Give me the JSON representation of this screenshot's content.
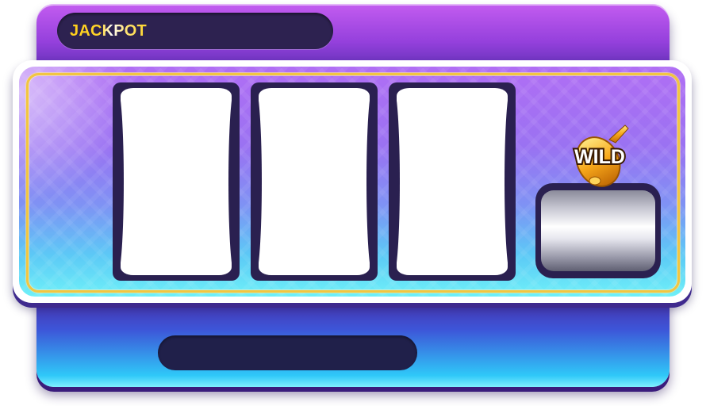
{
  "header": {
    "jackpot_label": "JACKPOT"
  },
  "wild": {
    "label": "WILD",
    "icon": "golden-wild-symbol-icon"
  },
  "reels": [
    {
      "name": "reel-1",
      "symbol": ""
    },
    {
      "name": "reel-2",
      "symbol": ""
    },
    {
      "name": "reel-3",
      "symbol": ""
    }
  ],
  "bottom_bar": {
    "text": ""
  },
  "colors": {
    "cabinet_top": "#c35cf0",
    "cabinet_body": "#4a2fa8",
    "cabinet_bottom": "#2fc8f8",
    "reel_frame": "#2a2050",
    "gold_accent": "#f2c640",
    "jackpot_text": "#ffcf1a"
  }
}
